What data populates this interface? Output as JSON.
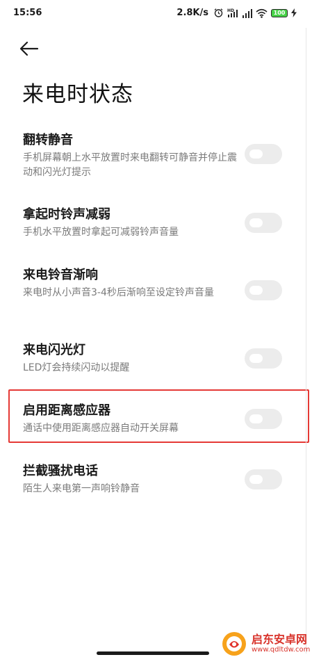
{
  "status_bar": {
    "time": "15:56",
    "speed": "2.8K/s",
    "battery": "100"
  },
  "header": {
    "title": "来电时状态"
  },
  "settings": [
    {
      "title": "翻转静音",
      "desc": "手机屏幕朝上水平放置时来电翻转可静音并停止震动和闪光灯提示",
      "enabled": false
    },
    {
      "title": "拿起时铃声减弱",
      "desc": "手机水平放置时拿起可减弱铃声音量",
      "enabled": false
    },
    {
      "title": "来电铃音渐响",
      "desc": "来电时从小声音3-4秒后渐响至设定铃声音量",
      "enabled": false
    },
    {
      "title": "来电闪光灯",
      "desc": "LED灯会持续闪动以提醒",
      "enabled": false
    },
    {
      "title": "启用距离感应器",
      "desc": "通话中使用距离感应器自动开关屏幕",
      "enabled": false,
      "highlighted": true
    },
    {
      "title": "拦截骚扰电话",
      "desc": "陌生人来电第一声响铃静音",
      "enabled": false
    }
  ],
  "watermark": {
    "main": "启东安卓网",
    "sub": "www.qdltdw.com"
  },
  "colors": {
    "highlight": "#e53935",
    "toggle_off": "#ececec",
    "battery": "#47d147",
    "watermark": "#d8332b"
  }
}
